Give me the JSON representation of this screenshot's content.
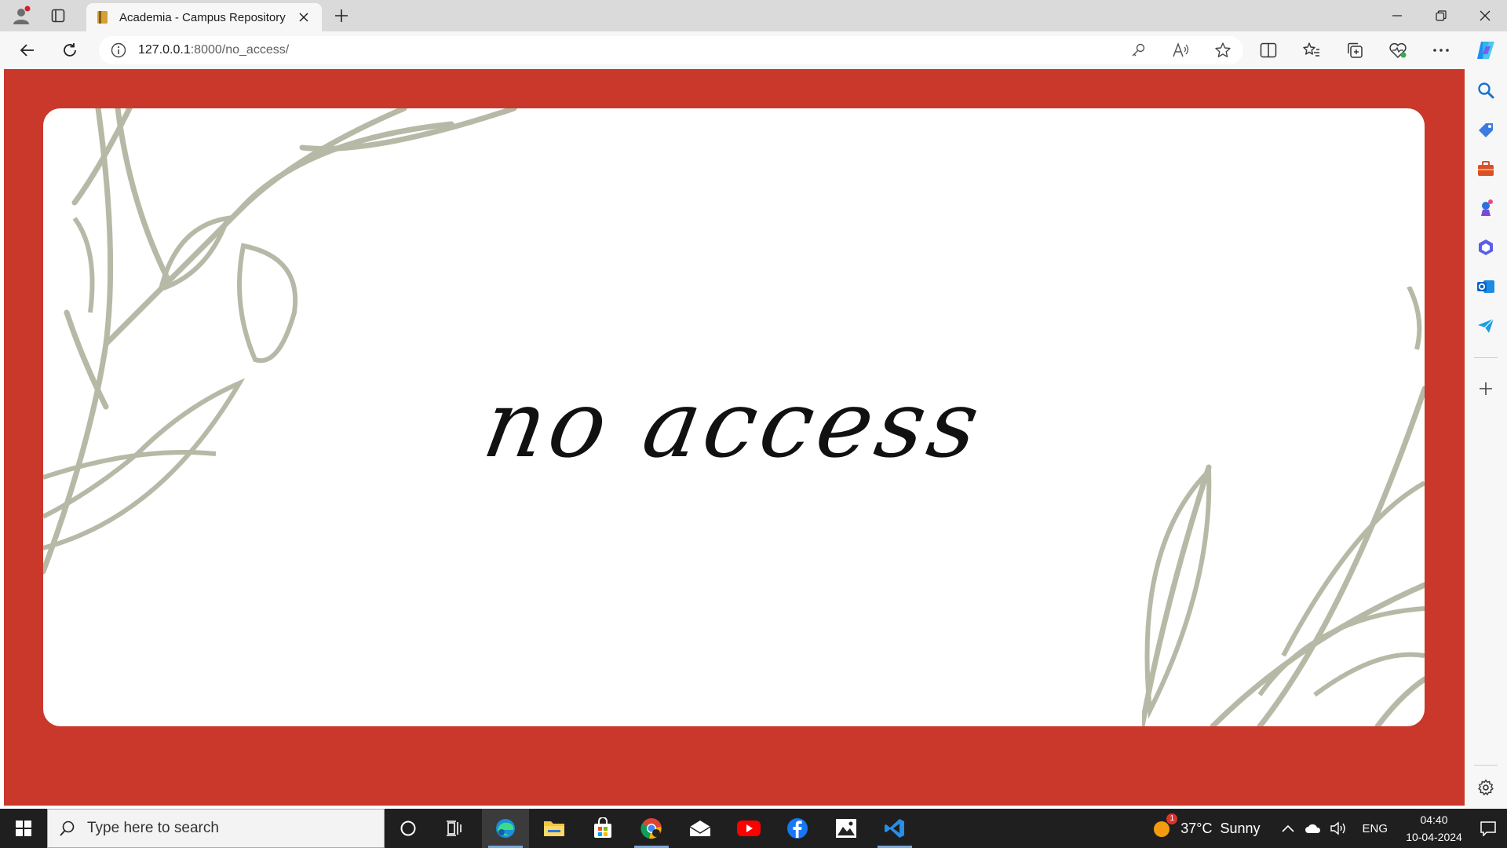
{
  "browser": {
    "tab": {
      "title": "Academia - Campus Repository"
    },
    "address": {
      "host": "127.0.0.1",
      "path": ":8000/no_access/"
    },
    "colors": {
      "page_bg": "#c9382b",
      "leaf": "#b7b9a7"
    }
  },
  "page": {
    "headline": "no access"
  },
  "taskbar": {
    "search_placeholder": "Type here to search",
    "weather": {
      "badge": "1",
      "temp": "37°C",
      "condition": "Sunny"
    },
    "lang": "ENG",
    "time": "04:40",
    "date": "10-04-2024"
  }
}
